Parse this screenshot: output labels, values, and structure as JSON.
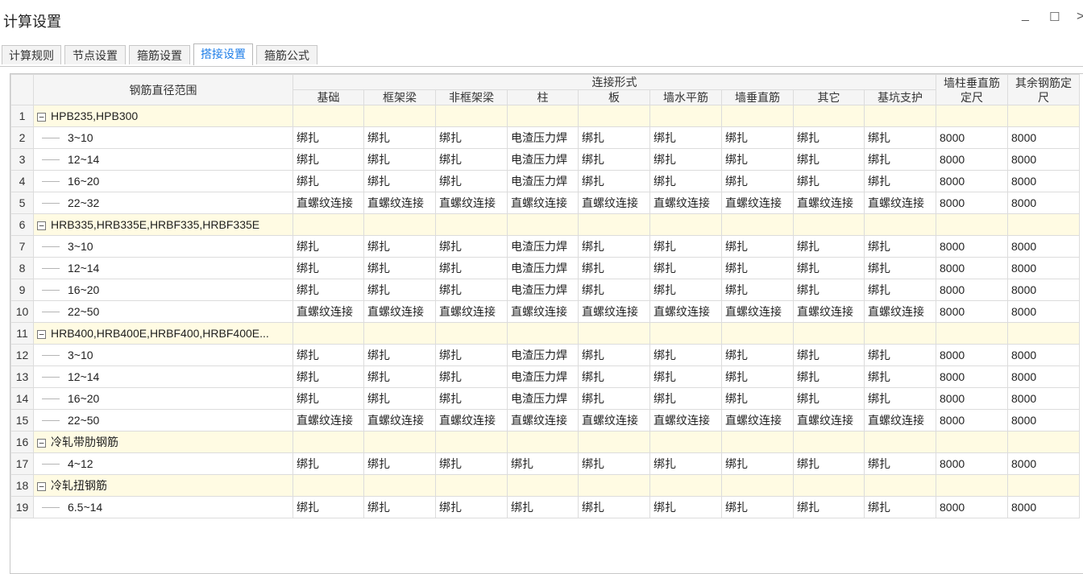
{
  "window": {
    "title": "计算设置",
    "minimize_glyph": "_",
    "maximize_glyph": "☐",
    "close_glyph": ">"
  },
  "tabs": [
    {
      "label": "计算规则"
    },
    {
      "label": "节点设置"
    },
    {
      "label": "箍筋设置"
    },
    {
      "label": "搭接设置",
      "active": true
    },
    {
      "label": "箍筋公式"
    }
  ],
  "table": {
    "header": {
      "diameter_range": "钢筋直径范围",
      "connection_group": "连接形式",
      "connection_columns": [
        "基础",
        "框架梁",
        "非框架梁",
        "柱",
        "板",
        "墙水平筋",
        "墙垂直筋",
        "其它",
        "基坑支护"
      ],
      "wall_col_vertical_fixed": "墙柱垂直筋定尺",
      "other_fixed": "其余钢筋定尺"
    },
    "rows": [
      {
        "num": "1",
        "type": "group",
        "label": "HPB235,HPB300"
      },
      {
        "num": "2",
        "type": "item",
        "label": "3~10",
        "values": [
          "绑扎",
          "绑扎",
          "绑扎",
          "电渣压力焊",
          "绑扎",
          "绑扎",
          "绑扎",
          "绑扎",
          "绑扎",
          "8000",
          "8000"
        ]
      },
      {
        "num": "3",
        "type": "item",
        "label": "12~14",
        "values": [
          "绑扎",
          "绑扎",
          "绑扎",
          "电渣压力焊",
          "绑扎",
          "绑扎",
          "绑扎",
          "绑扎",
          "绑扎",
          "8000",
          "8000"
        ]
      },
      {
        "num": "4",
        "type": "item",
        "label": "16~20",
        "values": [
          "绑扎",
          "绑扎",
          "绑扎",
          "电渣压力焊",
          "绑扎",
          "绑扎",
          "绑扎",
          "绑扎",
          "绑扎",
          "8000",
          "8000"
        ]
      },
      {
        "num": "5",
        "type": "item",
        "label": "22~32",
        "values": [
          "直螺纹连接",
          "直螺纹连接",
          "直螺纹连接",
          "直螺纹连接",
          "直螺纹连接",
          "直螺纹连接",
          "直螺纹连接",
          "直螺纹连接",
          "直螺纹连接",
          "8000",
          "8000"
        ]
      },
      {
        "num": "6",
        "type": "group",
        "label": "HRB335,HRB335E,HRBF335,HRBF335E"
      },
      {
        "num": "7",
        "type": "item",
        "label": "3~10",
        "values": [
          "绑扎",
          "绑扎",
          "绑扎",
          "电渣压力焊",
          "绑扎",
          "绑扎",
          "绑扎",
          "绑扎",
          "绑扎",
          "8000",
          "8000"
        ]
      },
      {
        "num": "8",
        "type": "item",
        "label": "12~14",
        "values": [
          "绑扎",
          "绑扎",
          "绑扎",
          "电渣压力焊",
          "绑扎",
          "绑扎",
          "绑扎",
          "绑扎",
          "绑扎",
          "8000",
          "8000"
        ]
      },
      {
        "num": "9",
        "type": "item",
        "label": "16~20",
        "values": [
          "绑扎",
          "绑扎",
          "绑扎",
          "电渣压力焊",
          "绑扎",
          "绑扎",
          "绑扎",
          "绑扎",
          "绑扎",
          "8000",
          "8000"
        ]
      },
      {
        "num": "10",
        "type": "item",
        "label": "22~50",
        "values": [
          "直螺纹连接",
          "直螺纹连接",
          "直螺纹连接",
          "直螺纹连接",
          "直螺纹连接",
          "直螺纹连接",
          "直螺纹连接",
          "直螺纹连接",
          "直螺纹连接",
          "8000",
          "8000"
        ]
      },
      {
        "num": "11",
        "type": "group",
        "label": "HRB400,HRB400E,HRBF400,HRBF400E..."
      },
      {
        "num": "12",
        "type": "item",
        "label": "3~10",
        "values": [
          "绑扎",
          "绑扎",
          "绑扎",
          "电渣压力焊",
          "绑扎",
          "绑扎",
          "绑扎",
          "绑扎",
          "绑扎",
          "8000",
          "8000"
        ]
      },
      {
        "num": "13",
        "type": "item",
        "label": "12~14",
        "values": [
          "绑扎",
          "绑扎",
          "绑扎",
          "电渣压力焊",
          "绑扎",
          "绑扎",
          "绑扎",
          "绑扎",
          "绑扎",
          "8000",
          "8000"
        ]
      },
      {
        "num": "14",
        "type": "item",
        "label": "16~20",
        "values": [
          "绑扎",
          "绑扎",
          "绑扎",
          "电渣压力焊",
          "绑扎",
          "绑扎",
          "绑扎",
          "绑扎",
          "绑扎",
          "8000",
          "8000"
        ]
      },
      {
        "num": "15",
        "type": "item",
        "label": "22~50",
        "values": [
          "直螺纹连接",
          "直螺纹连接",
          "直螺纹连接",
          "直螺纹连接",
          "直螺纹连接",
          "直螺纹连接",
          "直螺纹连接",
          "直螺纹连接",
          "直螺纹连接",
          "8000",
          "8000"
        ]
      },
      {
        "num": "16",
        "type": "group",
        "label": "冷轧带肋钢筋"
      },
      {
        "num": "17",
        "type": "item",
        "label": "4~12",
        "values": [
          "绑扎",
          "绑扎",
          "绑扎",
          "绑扎",
          "绑扎",
          "绑扎",
          "绑扎",
          "绑扎",
          "绑扎",
          "8000",
          "8000"
        ]
      },
      {
        "num": "18",
        "type": "group",
        "label": "冷轧扭钢筋"
      },
      {
        "num": "19",
        "type": "item",
        "label": "6.5~14",
        "values": [
          "绑扎",
          "绑扎",
          "绑扎",
          "绑扎",
          "绑扎",
          "绑扎",
          "绑扎",
          "绑扎",
          "绑扎",
          "8000",
          "8000"
        ]
      }
    ]
  }
}
